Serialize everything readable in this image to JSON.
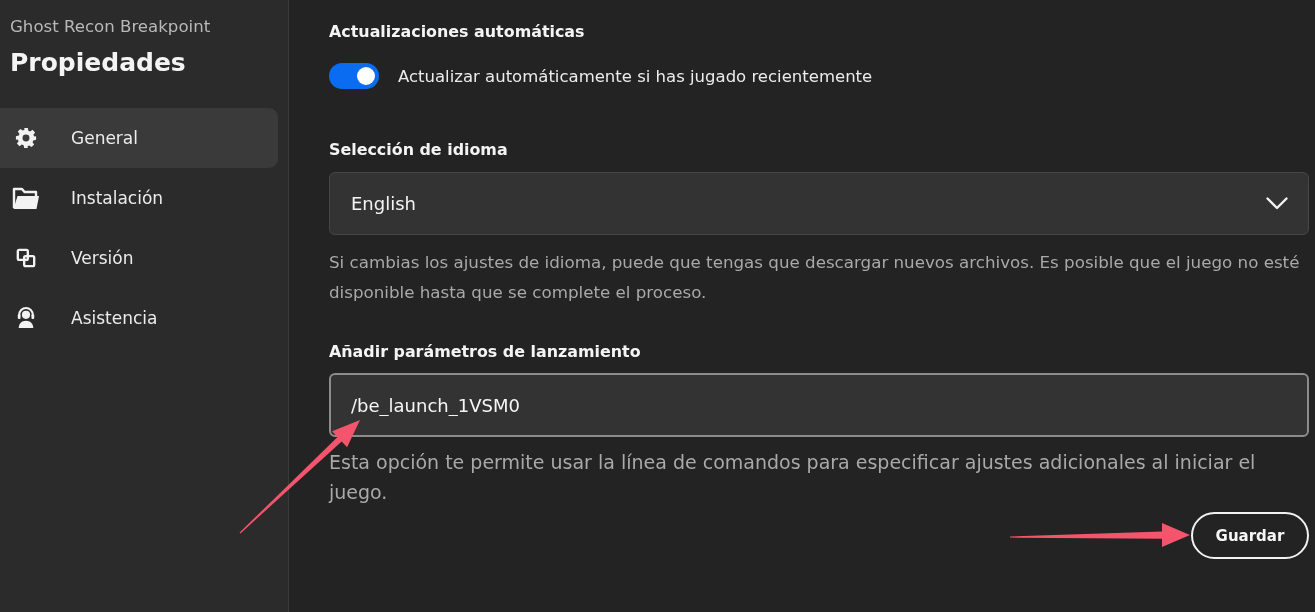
{
  "window": {
    "subtitle": "Ghost Recon Breakpoint",
    "title": "Propiedades"
  },
  "sidebar": {
    "items": [
      {
        "label": "General",
        "selected": true
      },
      {
        "label": "Instalación",
        "selected": false
      },
      {
        "label": "Versión",
        "selected": false
      },
      {
        "label": "Asistencia",
        "selected": false
      }
    ]
  },
  "sections": [
    {
      "kind": "toggle",
      "heading": "Actualizaciones automáticas",
      "label": "Actualizar automáticamente si has jugado recientemente",
      "on": true
    },
    {
      "kind": "select",
      "heading": "Selección de idioma",
      "value": "English",
      "help": "Si cambias los ajustes de idioma, puede que tengas que descargar nuevos archivos. Es posible que el juego no esté disponible hasta que se complete el proceso."
    },
    {
      "kind": "text",
      "heading": "Añadir parámetros de lanzamiento",
      "value": "/be_launch_1VSM0",
      "help": "Esta opción te permite usar la línea de comandos para especificar ajustes adicionales al iniciar el juego."
    }
  ],
  "save_button": {
    "label": "Guardar"
  }
}
